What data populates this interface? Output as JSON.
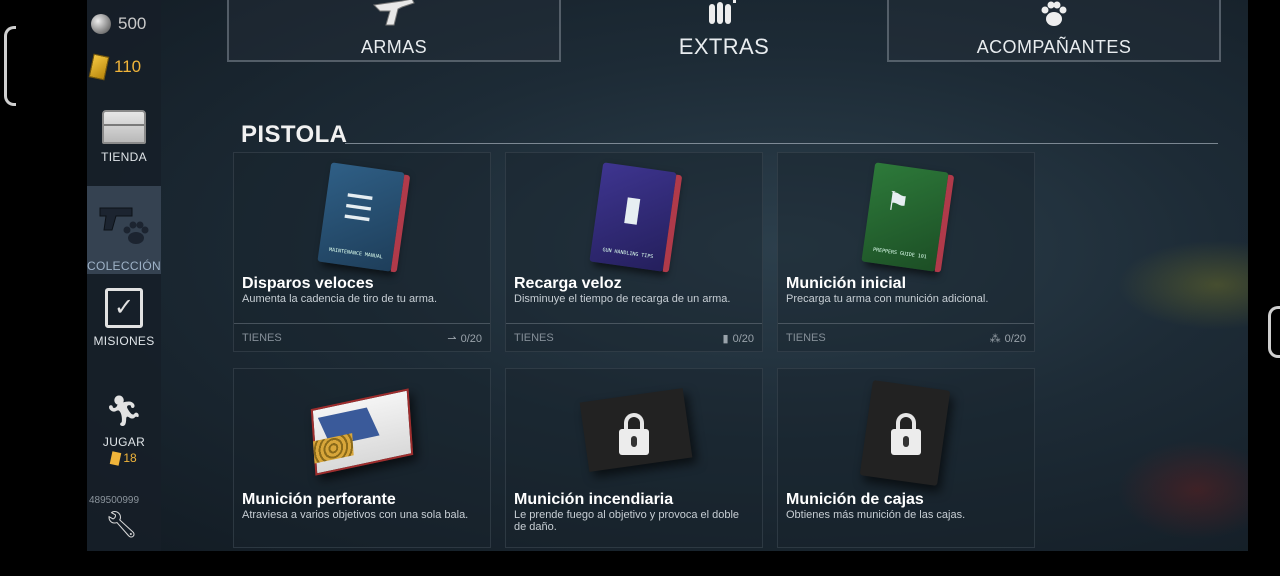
{
  "sidebar": {
    "silver": "500",
    "gold": "110",
    "items": [
      {
        "label": "TIENDA"
      },
      {
        "label": "COLECCIÓN"
      },
      {
        "label": "MISIONES"
      },
      {
        "label": "JUGAR",
        "badge": "18"
      }
    ],
    "user_id": "489500999"
  },
  "tabs": [
    {
      "label": "ARMAS",
      "icon": "revolver-icon"
    },
    {
      "label": "EXTRAS",
      "icon": "bullets-plus-icon",
      "active": true
    },
    {
      "label": "ACOMPAÑANTES",
      "icon": "paw-icon"
    }
  ],
  "section": {
    "title": "PISTOLA"
  },
  "cards": [
    {
      "title": "Disparos veloces",
      "desc": "Aumenta la cadencia de tiro de tu arma.",
      "have": "TIENES",
      "count": "0/20",
      "book_text": "MAINTENANCE MANUAL"
    },
    {
      "title": "Recarga veloz",
      "desc": "Disminuye el tiempo de recarga de un arma.",
      "have": "TIENES",
      "count": "0/20",
      "book_text": "GUN HANDLING TIPS"
    },
    {
      "title": "Munición inicial",
      "desc": "Precarga tu arma con munición adicional.",
      "have": "TIENES",
      "count": "0/20",
      "book_text": "PREPPERS GUIDE 101"
    },
    {
      "title": "Munición perforante",
      "desc": "Atraviesa a varios objetivos con una sola bala."
    },
    {
      "title": "Munición incendiaria",
      "desc": "Le prende fuego al objetivo y provoca el doble de daño."
    },
    {
      "title": "Munición de cajas",
      "desc": "Obtienes más munición de las cajas."
    }
  ]
}
